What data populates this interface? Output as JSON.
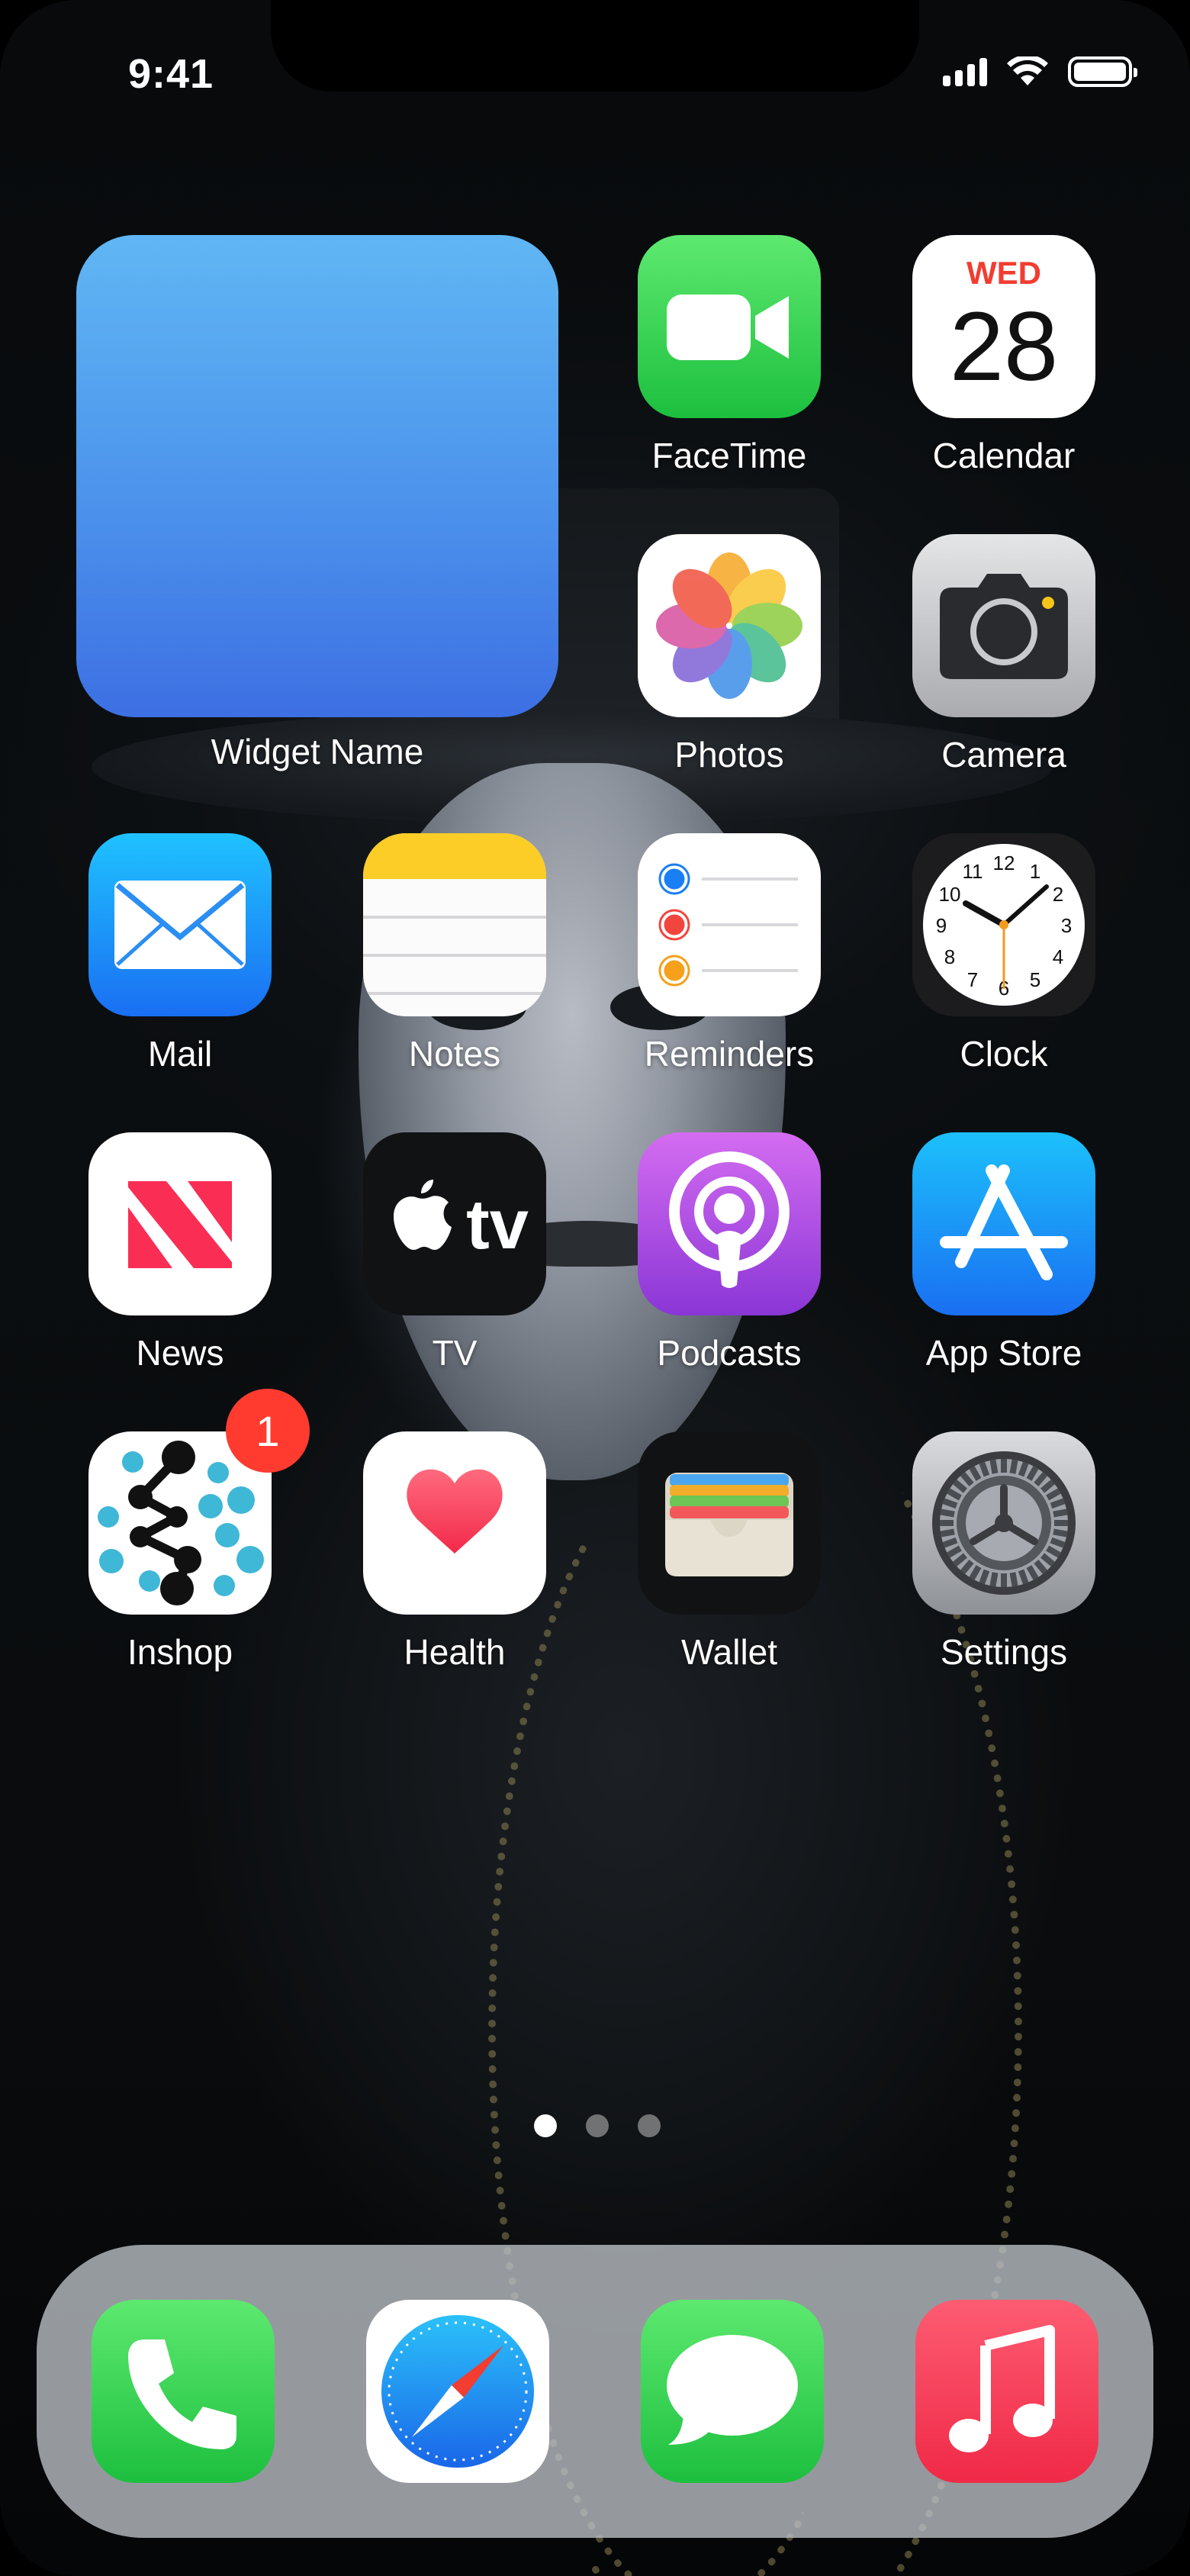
{
  "status_bar": {
    "time": "9:41",
    "icons": [
      "cellular-signal-icon",
      "wifi-icon",
      "battery-icon"
    ]
  },
  "widget": {
    "label": "Widget Name",
    "colors": [
      "#60b7f4",
      "#3d6fe3"
    ]
  },
  "apps": {
    "facetime": {
      "label": "FaceTime",
      "icon": "video-camera-icon"
    },
    "calendar": {
      "label": "Calendar",
      "day": "WED",
      "date": "28",
      "icon": "calendar-icon"
    },
    "photos": {
      "label": "Photos",
      "icon": "photos-flower-icon"
    },
    "camera": {
      "label": "Camera",
      "icon": "camera-icon"
    },
    "mail": {
      "label": "Mail",
      "icon": "envelope-icon"
    },
    "notes": {
      "label": "Notes",
      "icon": "notepad-icon"
    },
    "reminders": {
      "label": "Reminders",
      "icon": "checklist-icon"
    },
    "clock": {
      "label": "Clock",
      "icon": "clock-face-icon",
      "numerals": [
        "12",
        "1",
        "2",
        "3",
        "4",
        "5",
        "6",
        "7",
        "8",
        "9",
        "10",
        "11"
      ]
    },
    "news": {
      "label": "News",
      "icon": "news-n-icon"
    },
    "tv": {
      "label": "TV",
      "logo_text": "tv",
      "icon": "apple-tv-icon"
    },
    "podcasts": {
      "label": "Podcasts",
      "icon": "podcast-icon"
    },
    "app_store": {
      "label": "App Store",
      "icon": "app-store-a-icon"
    },
    "inshop": {
      "label": "Inshop",
      "badge": "1",
      "icon": "molecule-dots-icon"
    },
    "health": {
      "label": "Health",
      "icon": "heart-icon"
    },
    "wallet": {
      "label": "Wallet",
      "icon": "wallet-cards-icon"
    },
    "settings": {
      "label": "Settings",
      "icon": "gear-icon"
    }
  },
  "page_indicator": {
    "pages": 3,
    "current": 1
  },
  "dock": {
    "apps": [
      {
        "name": "phone",
        "icon": "phone-handset-icon"
      },
      {
        "name": "safari",
        "icon": "compass-icon"
      },
      {
        "name": "messages",
        "icon": "speech-bubble-icon"
      },
      {
        "name": "music",
        "icon": "music-note-icon"
      }
    ]
  },
  "colors": {
    "badge": "#ff3b30",
    "green": "#33c759",
    "blue": "#1a8cf5",
    "purple": "#a75de0",
    "red": "#fa3c5a"
  }
}
